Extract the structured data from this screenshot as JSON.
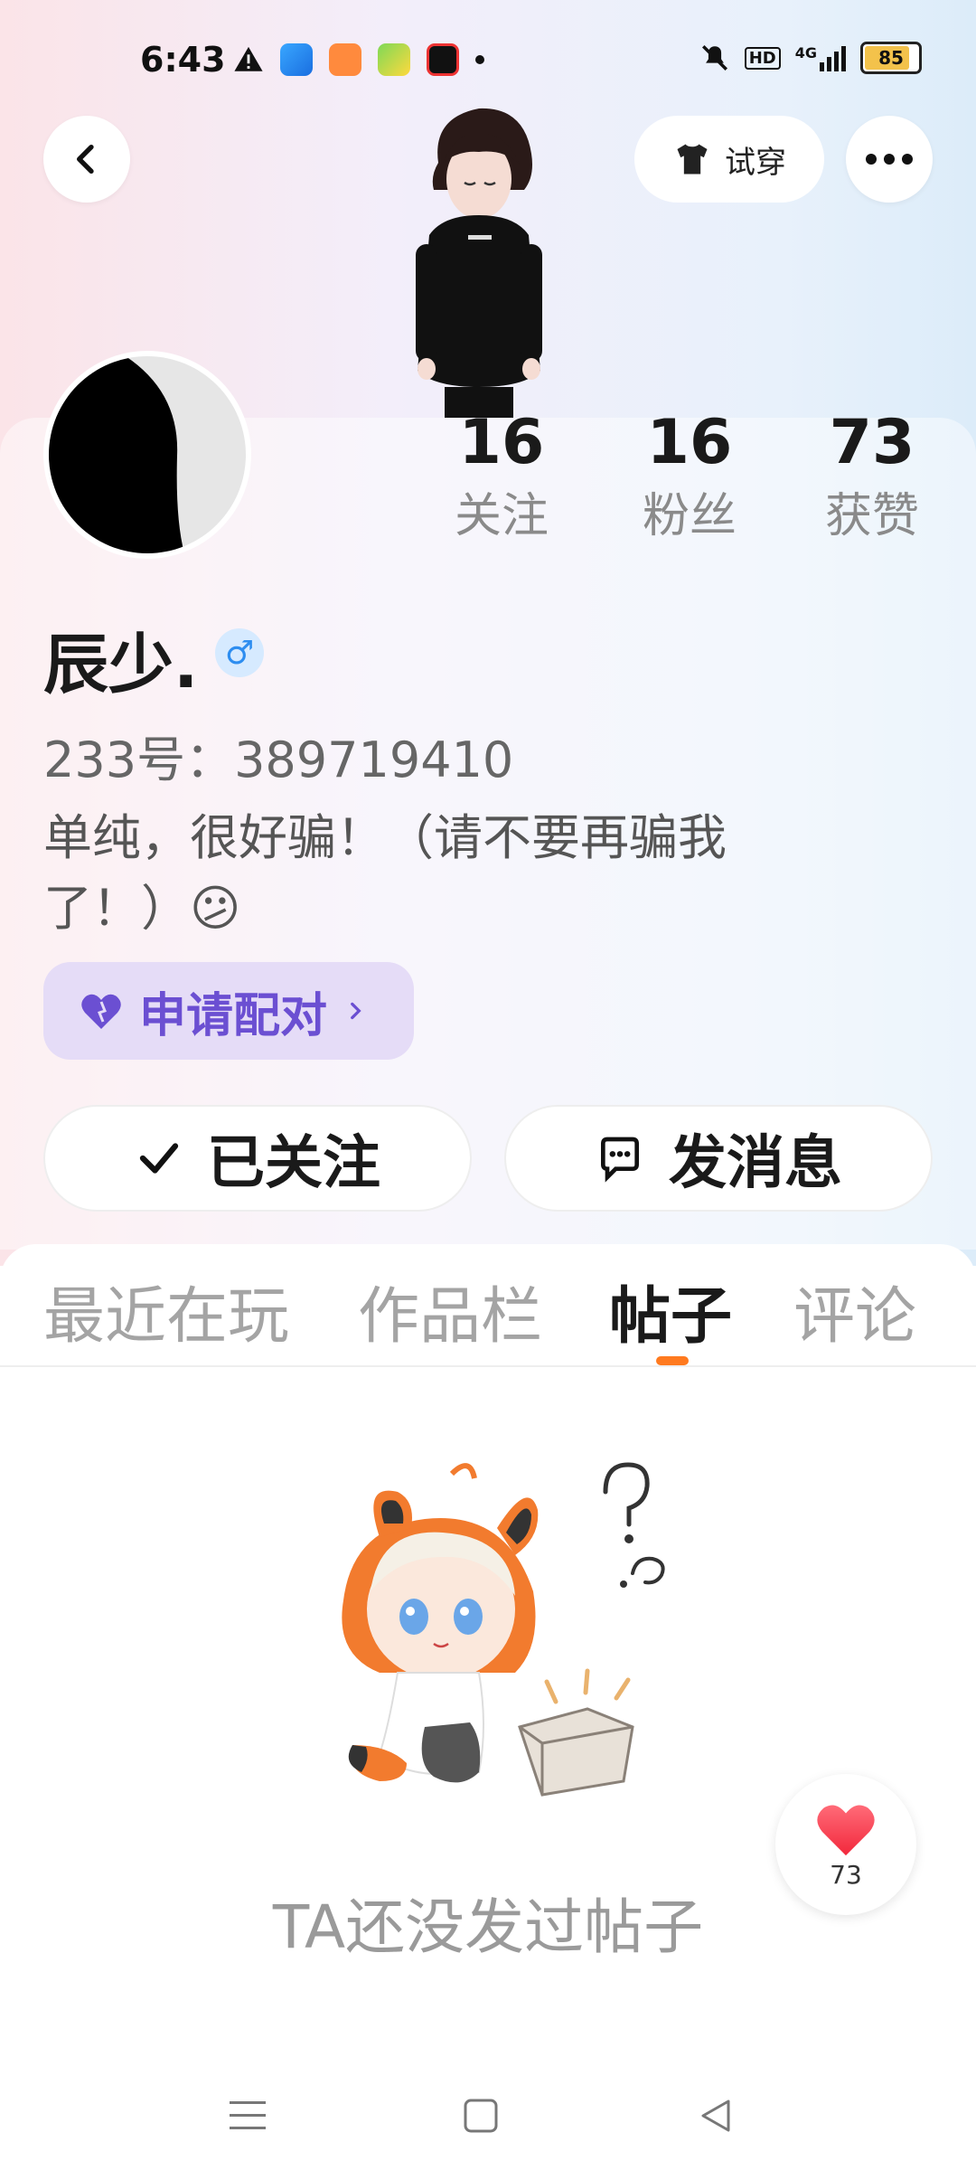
{
  "status_bar": {
    "time": "6:43",
    "battery": "85",
    "battery_level": 0.85,
    "signal": "4G"
  },
  "header": {
    "try_on_label": "试穿"
  },
  "profile": {
    "name": "辰少.",
    "gender_symbol": "♂",
    "id_text": "233号：389719410",
    "bio": "单纯，很好骗！（请不要再骗我了！）😕",
    "pair_label": "申请配对",
    "stats": [
      {
        "value": "16",
        "label": "关注"
      },
      {
        "value": "16",
        "label": "粉丝"
      },
      {
        "value": "73",
        "label": "获赞"
      }
    ]
  },
  "actions": {
    "follow_label": "已关注",
    "message_label": "发消息"
  },
  "tabs": [
    {
      "label": "最近在玩"
    },
    {
      "label": "作品栏"
    },
    {
      "label": "帖子"
    },
    {
      "label": "评论"
    }
  ],
  "active_tab": "帖子",
  "empty_state": {
    "text": "TA还没发过帖子"
  },
  "like_fab": {
    "count": "73"
  },
  "colors": {
    "accent": "#ff7a1f",
    "pair_text": "#6b4fd2",
    "pair_bg": "#e5dcf7"
  }
}
